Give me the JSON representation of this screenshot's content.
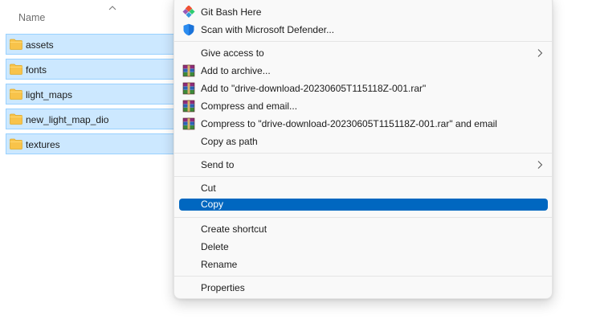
{
  "file_list": {
    "column_name": "Name",
    "items": [
      {
        "name": "assets"
      },
      {
        "name": "fonts"
      },
      {
        "name": "light_maps"
      },
      {
        "name": "new_light_map_dio"
      },
      {
        "name": "textures"
      }
    ]
  },
  "context_menu": {
    "git_bash": "Git Bash Here",
    "defender": "Scan with Microsoft Defender...",
    "give_access": "Give access to",
    "add_archive": "Add to archive...",
    "add_to_rar": "Add to \"drive-download-20230605T115118Z-001.rar\"",
    "compress_email": "Compress and email...",
    "compress_rar_email": "Compress to \"drive-download-20230605T115118Z-001.rar\" and email",
    "copy_as_path": "Copy as path",
    "send_to": "Send to",
    "cut": "Cut",
    "copy": "Copy",
    "create_shortcut": "Create shortcut",
    "delete": "Delete",
    "rename": "Rename",
    "properties": "Properties",
    "highlighted_item": "Copy"
  },
  "colors": {
    "selection_bg": "#cce8ff",
    "selection_border": "#99d1ff",
    "highlight": "#0067c0",
    "folder": "#f8c34a"
  }
}
